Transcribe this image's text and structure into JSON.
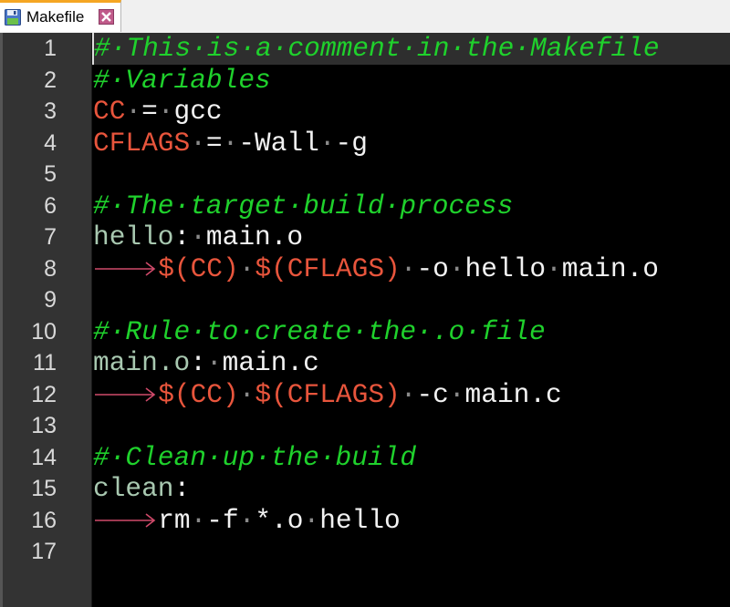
{
  "tab": {
    "label": "Makefile",
    "icon": "save-icon",
    "close_icon": "close-icon"
  },
  "editor": {
    "current_line": 1,
    "colors": {
      "comment": "#1fd12c",
      "variable": "#e8553c",
      "target": "#a8c8b0",
      "text": "#f2f2f2",
      "whitespace_marker": "#8a8a8a",
      "tab_arrow": "#d04a6a",
      "gutter_bg": "#333333",
      "editor_bg": "#000000",
      "current_line_bg": "#2e2e2e"
    },
    "lines": [
      {
        "n": "1",
        "tokens": [
          {
            "t": "comment",
            "v": "#·This·is·a·comment·in·the·Makefile"
          }
        ]
      },
      {
        "n": "2",
        "tokens": [
          {
            "t": "comment",
            "v": "#·Variables"
          }
        ]
      },
      {
        "n": "3",
        "tokens": [
          {
            "t": "var",
            "v": "CC"
          },
          {
            "t": "ws",
            "v": "·"
          },
          {
            "t": "text",
            "v": "="
          },
          {
            "t": "ws",
            "v": "·"
          },
          {
            "t": "text",
            "v": "gcc"
          }
        ]
      },
      {
        "n": "4",
        "tokens": [
          {
            "t": "var",
            "v": "CFLAGS"
          },
          {
            "t": "ws",
            "v": "·"
          },
          {
            "t": "text",
            "v": "="
          },
          {
            "t": "ws",
            "v": "·"
          },
          {
            "t": "text",
            "v": "-Wall"
          },
          {
            "t": "ws",
            "v": "·"
          },
          {
            "t": "text",
            "v": "-g"
          }
        ]
      },
      {
        "n": "5",
        "tokens": []
      },
      {
        "n": "6",
        "tokens": [
          {
            "t": "comment",
            "v": "#·The·target·build·process"
          }
        ]
      },
      {
        "n": "7",
        "tokens": [
          {
            "t": "target",
            "v": "hello"
          },
          {
            "t": "text",
            "v": ":"
          },
          {
            "t": "ws",
            "v": "·"
          },
          {
            "t": "text",
            "v": "main.o"
          }
        ]
      },
      {
        "n": "8",
        "tokens": [
          {
            "t": "tab",
            "v": ""
          },
          {
            "t": "var",
            "v": "$(CC)"
          },
          {
            "t": "ws",
            "v": "·"
          },
          {
            "t": "var",
            "v": "$(CFLAGS)"
          },
          {
            "t": "ws",
            "v": "·"
          },
          {
            "t": "text",
            "v": "-o"
          },
          {
            "t": "ws",
            "v": "·"
          },
          {
            "t": "text",
            "v": "hello"
          },
          {
            "t": "ws",
            "v": "·"
          },
          {
            "t": "text",
            "v": "main.o"
          }
        ]
      },
      {
        "n": "9",
        "tokens": []
      },
      {
        "n": "10",
        "tokens": [
          {
            "t": "comment",
            "v": "#·Rule·to·create·the·.o·file"
          }
        ]
      },
      {
        "n": "11",
        "tokens": [
          {
            "t": "target",
            "v": "main.o"
          },
          {
            "t": "text",
            "v": ":"
          },
          {
            "t": "ws",
            "v": "·"
          },
          {
            "t": "text",
            "v": "main.c"
          }
        ]
      },
      {
        "n": "12",
        "tokens": [
          {
            "t": "tab",
            "v": ""
          },
          {
            "t": "var",
            "v": "$(CC)"
          },
          {
            "t": "ws",
            "v": "·"
          },
          {
            "t": "var",
            "v": "$(CFLAGS)"
          },
          {
            "t": "ws",
            "v": "·"
          },
          {
            "t": "text",
            "v": "-c"
          },
          {
            "t": "ws",
            "v": "·"
          },
          {
            "t": "text",
            "v": "main.c"
          }
        ]
      },
      {
        "n": "13",
        "tokens": []
      },
      {
        "n": "14",
        "tokens": [
          {
            "t": "comment",
            "v": "#·Clean·up·the·build"
          }
        ]
      },
      {
        "n": "15",
        "tokens": [
          {
            "t": "target",
            "v": "clean"
          },
          {
            "t": "text",
            "v": ":"
          }
        ]
      },
      {
        "n": "16",
        "tokens": [
          {
            "t": "tab",
            "v": ""
          },
          {
            "t": "text",
            "v": "rm"
          },
          {
            "t": "ws",
            "v": "·"
          },
          {
            "t": "text",
            "v": "-f"
          },
          {
            "t": "ws",
            "v": "·"
          },
          {
            "t": "text",
            "v": "*.o"
          },
          {
            "t": "ws",
            "v": "·"
          },
          {
            "t": "text",
            "v": "hello"
          }
        ]
      },
      {
        "n": "17",
        "tokens": []
      }
    ]
  }
}
